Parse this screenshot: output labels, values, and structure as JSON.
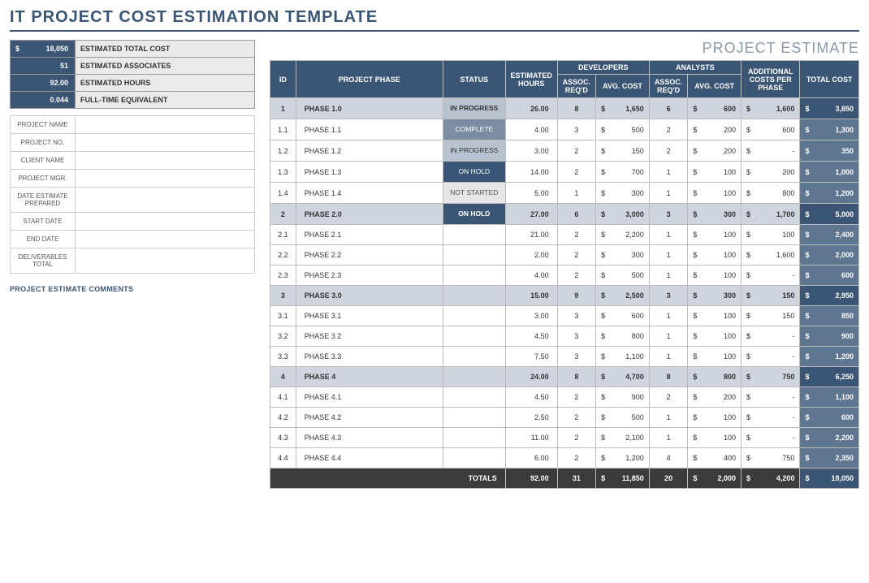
{
  "title": "IT PROJECT COST ESTIMATION TEMPLATE",
  "projectEstimateLabel": "PROJECT ESTIMATE",
  "summary": [
    {
      "value": "18,050",
      "prefix": "$",
      "label": "ESTIMATED TOTAL COST"
    },
    {
      "value": "51",
      "prefix": "",
      "label": "ESTIMATED ASSOCIATES"
    },
    {
      "value": "92.00",
      "prefix": "",
      "label": "ESTIMATED HOURS"
    },
    {
      "value": "0.044",
      "prefix": "",
      "label": "FULL-TIME EQUIVALENT"
    }
  ],
  "info": [
    {
      "label": "PROJECT NAME",
      "value": ""
    },
    {
      "label": "PROJECT NO.",
      "value": ""
    },
    {
      "label": "CLIENT NAME",
      "value": ""
    },
    {
      "label": "PROJECT MGR.",
      "value": ""
    },
    {
      "label": "DATE ESTIMATE PREPARED",
      "value": ""
    },
    {
      "label": "START DATE",
      "value": ""
    },
    {
      "label": "END DATE",
      "value": ""
    },
    {
      "label": "DELIVERABLES TOTAL",
      "value": ""
    }
  ],
  "commentsLabel": "PROJECT ESTIMATE COMMENTS",
  "headers": {
    "id": "ID",
    "phase": "PROJECT PHASE",
    "status": "STATUS",
    "hours": "ESTIMATED HOURS",
    "dev": "DEVELOPERS",
    "ana": "ANALYSTS",
    "assoc": "ASSOC. REQ'D",
    "avg": "AVG. COST",
    "add": "ADDITIONAL COSTS PER PHASE",
    "total": "TOTAL COST",
    "totals": "TOTALS"
  },
  "statusLabels": {
    "inprogress": "IN PROGRESS",
    "complete": "COMPLETE",
    "onhold": "ON HOLD",
    "notstarted": "NOT STARTED"
  },
  "rows": [
    {
      "parent": true,
      "id": "1",
      "phase": "PHASE 1.0",
      "status": "inprogress",
      "hours": "26.00",
      "devA": "8",
      "devC": "1,650",
      "anaA": "6",
      "anaC": "600",
      "add": "1,600",
      "total": "3,850"
    },
    {
      "id": "1.1",
      "phase": "PHASE 1.1",
      "status": "complete",
      "hours": "4.00",
      "devA": "3",
      "devC": "500",
      "anaA": "2",
      "anaC": "200",
      "add": "600",
      "total": "1,300"
    },
    {
      "id": "1.2",
      "phase": "PHASE 1.2",
      "status": "inprogress",
      "hours": "3.00",
      "devA": "2",
      "devC": "150",
      "anaA": "2",
      "anaC": "200",
      "add": "-",
      "total": "350"
    },
    {
      "id": "1.3",
      "phase": "PHASE 1.3",
      "status": "onhold",
      "hours": "14.00",
      "devA": "2",
      "devC": "700",
      "anaA": "1",
      "anaC": "100",
      "add": "200",
      "total": "1,000"
    },
    {
      "id": "1.4",
      "phase": "PHASE 1.4",
      "status": "notstarted",
      "hours": "5.00",
      "devA": "1",
      "devC": "300",
      "anaA": "1",
      "anaC": "100",
      "add": "800",
      "total": "1,200"
    },
    {
      "parent": true,
      "id": "2",
      "phase": "PHASE 2.0",
      "status": "onhold",
      "hours": "27.00",
      "devA": "6",
      "devC": "3,000",
      "anaA": "3",
      "anaC": "300",
      "add": "1,700",
      "total": "5,000"
    },
    {
      "id": "2.1",
      "phase": "PHASE 2.1",
      "status": "",
      "hours": "21.00",
      "devA": "2",
      "devC": "2,200",
      "anaA": "1",
      "anaC": "100",
      "add": "100",
      "total": "2,400"
    },
    {
      "id": "2.2",
      "phase": "PHASE 2.2",
      "status": "",
      "hours": "2.00",
      "devA": "2",
      "devC": "300",
      "anaA": "1",
      "anaC": "100",
      "add": "1,600",
      "total": "2,000"
    },
    {
      "id": "2.3",
      "phase": "PHASE 2.3",
      "status": "",
      "hours": "4.00",
      "devA": "2",
      "devC": "500",
      "anaA": "1",
      "anaC": "100",
      "add": "-",
      "total": "600"
    },
    {
      "parent": true,
      "id": "3",
      "phase": "PHASE 3.0",
      "status": "",
      "hours": "15.00",
      "devA": "9",
      "devC": "2,500",
      "anaA": "3",
      "anaC": "300",
      "add": "150",
      "total": "2,950"
    },
    {
      "id": "3.1",
      "phase": "PHASE 3.1",
      "status": "",
      "hours": "3.00",
      "devA": "3",
      "devC": "600",
      "anaA": "1",
      "anaC": "100",
      "add": "150",
      "total": "850"
    },
    {
      "id": "3.2",
      "phase": "PHASE 3.2",
      "status": "",
      "hours": "4.50",
      "devA": "3",
      "devC": "800",
      "anaA": "1",
      "anaC": "100",
      "add": "-",
      "total": "900"
    },
    {
      "id": "3.3",
      "phase": "PHASE 3.3",
      "status": "",
      "hours": "7.50",
      "devA": "3",
      "devC": "1,100",
      "anaA": "1",
      "anaC": "100",
      "add": "-",
      "total": "1,200"
    },
    {
      "parent": true,
      "id": "4",
      "phase": "PHASE 4",
      "status": "",
      "hours": "24.00",
      "devA": "8",
      "devC": "4,700",
      "anaA": "8",
      "anaC": "800",
      "add": "750",
      "total": "6,250"
    },
    {
      "id": "4.1",
      "phase": "PHASE 4.1",
      "status": "",
      "hours": "4.50",
      "devA": "2",
      "devC": "900",
      "anaA": "2",
      "anaC": "200",
      "add": "-",
      "total": "1,100"
    },
    {
      "id": "4.2",
      "phase": "PHASE 4.2",
      "status": "",
      "hours": "2.50",
      "devA": "2",
      "devC": "500",
      "anaA": "1",
      "anaC": "100",
      "add": "-",
      "total": "600"
    },
    {
      "id": "4.3",
      "phase": "PHASE 4.3",
      "status": "",
      "hours": "11.00",
      "devA": "2",
      "devC": "2,100",
      "anaA": "1",
      "anaC": "100",
      "add": "-",
      "total": "2,200"
    },
    {
      "id": "4.4",
      "phase": "PHASE 4.4",
      "status": "",
      "hours": "6.00",
      "devA": "2",
      "devC": "1,200",
      "anaA": "4",
      "anaC": "400",
      "add": "750",
      "total": "2,350"
    }
  ],
  "totals": {
    "hours": "92.00",
    "devA": "31",
    "devC": "11,850",
    "anaA": "20",
    "anaC": "2,000",
    "add": "4,200",
    "total": "18,050"
  }
}
